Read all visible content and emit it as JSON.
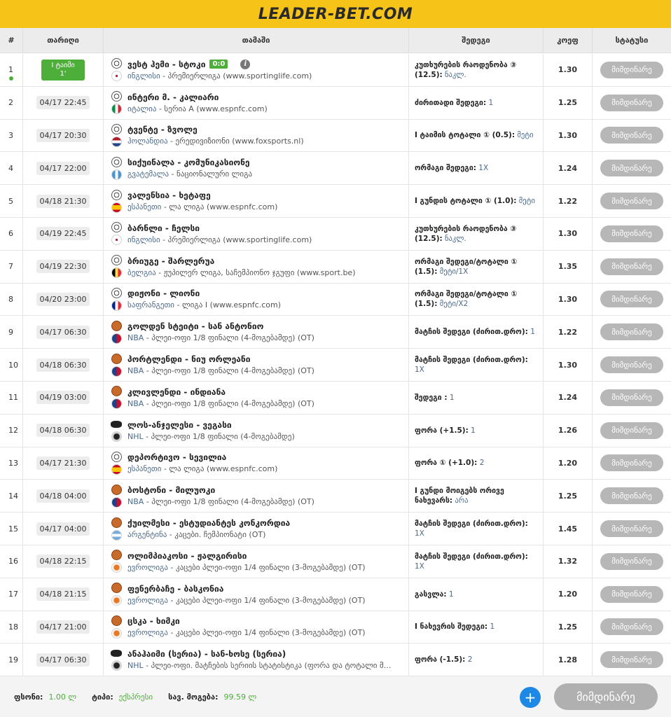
{
  "brand": {
    "logo": "LEADER-BET.COM"
  },
  "columns": {
    "num": "#",
    "date": "თარიღი",
    "game": "თამაში",
    "result": "შედეგი",
    "odd": "კოეფ",
    "status": "სტატუსი"
  },
  "rows": [
    {
      "num": "1",
      "live": true,
      "live_l1": "I ტაიმი",
      "live_l2": "1'",
      "date": "",
      "sport": "football",
      "flag": "england",
      "title": "ვესტ ჰემი - სტოკი",
      "score": "0:0",
      "league": "ინგლისი",
      "sub": " - პრემიერლიგა (www.sportinglife.com)",
      "res_label": "კუთხურების რაოდენობა ③ (12.5):",
      "res_value": "ნაკლ.",
      "odd": "1.30",
      "status": "მიმდინარე"
    },
    {
      "num": "2",
      "date": "04/17 22:45",
      "sport": "football",
      "flag": "italy",
      "title": "ინტერი მ. - კალიარი",
      "league": "იტალია",
      "sub": " - სერია A (www.espnfc.com)",
      "res_label": "ძირითადი შედეგი:",
      "res_value": "1",
      "odd": "1.25",
      "status": "მიმდინარე"
    },
    {
      "num": "3",
      "date": "04/17 20:30",
      "sport": "football",
      "flag": "netherlands",
      "title": "ტვენტე - ზვოლე",
      "league": "ჰოლანდია",
      "sub": " - ერედივიზიონი (www.foxsports.nl)",
      "res_label": "I ტაიმის ტოტალი ① (0.5):",
      "res_value": "მეტი",
      "odd": "1.30",
      "status": "მიმდინარე"
    },
    {
      "num": "4",
      "date": "04/17 22:00",
      "sport": "football",
      "flag": "guatemala",
      "title": "სიქუინალა - კომუნიკასიონე",
      "league": "გვატემალა",
      "sub": " - ნაციონალური ლიგა",
      "res_label": "ორმაგი შედეგი:",
      "res_value": "1X",
      "odd": "1.24",
      "status": "მიმდინარე"
    },
    {
      "num": "5",
      "date": "04/18 21:30",
      "sport": "football",
      "flag": "spain",
      "title": "ვალენსია - ხეტაფე",
      "league": "ესპანეთი",
      "sub": " - ლა ლიგა (www.espnfc.com)",
      "res_label": "I გუნდის ტოტალი ① (1.0):",
      "res_value": "მეტი",
      "odd": "1.22",
      "status": "მიმდინარე"
    },
    {
      "num": "6",
      "date": "04/19 22:45",
      "sport": "football",
      "flag": "england",
      "title": "ბარნლი - ჩელსი",
      "league": "ინგლისი",
      "sub": " - პრემიერლიგა (www.sportinglife.com)",
      "res_label": "კუთხურების რაოდენობა ③ (12.5):",
      "res_value": "ნაკლ.",
      "odd": "1.30",
      "status": "მიმდინარე"
    },
    {
      "num": "7",
      "date": "04/19 22:30",
      "sport": "football",
      "flag": "belgium",
      "title": "ბრიუგე - შარლერუა",
      "league": "ბელგია",
      "sub": " - ჟუპილერ ლიგა, საჩემპიონო ჯგუფი (www.sport.be)",
      "res_label": "ორმაგი შედეგი/ტოტალი ① (1.5):",
      "res_value": "მეტი/1X",
      "odd": "1.35",
      "status": "მიმდინარე"
    },
    {
      "num": "8",
      "date": "04/20 23:00",
      "sport": "football",
      "flag": "france",
      "title": "დიჟონი - ლიონი",
      "league": "საფრანგეთი",
      "sub": " - ლიგა I (www.espnfc.com)",
      "res_label": "ორმაგი შედეგი/ტოტალი ① (1.5):",
      "res_value": "მეტი/X2",
      "odd": "1.30",
      "status": "მიმდინარე"
    },
    {
      "num": "9",
      "date": "04/17 06:30",
      "sport": "basketball",
      "flag": "nba",
      "title": "გოლდენ სტეიტი - სან ანტონიო",
      "league": "NBA",
      "sub": " - პლეი-ოფი 1/8 ფინალი (4-მოგებამდე) (OT)",
      "res_label": "მატჩის შედეგი (ძირით.დრო):",
      "res_value": "1",
      "odd": "1.22",
      "status": "მიმდინარე"
    },
    {
      "num": "10",
      "date": "04/18 06:30",
      "sport": "basketball",
      "flag": "nba",
      "title": "პორტლენდი - ნიუ ორლეანი",
      "league": "NBA",
      "sub": " - პლეი-ოფი 1/8 ფინალი (4-მოგებამდე) (OT)",
      "res_label": "მატჩის შედეგი (ძირით.დრო):",
      "res_value": "1X",
      "odd": "1.30",
      "status": "მიმდინარე"
    },
    {
      "num": "11",
      "date": "04/19 03:00",
      "sport": "basketball",
      "flag": "nba",
      "title": "კლივლენდი - ინდიანა",
      "league": "NBA",
      "sub": " - პლეი-ოფი 1/8 ფინალი (4-მოგებამდე) (OT)",
      "res_label": "შედეგი :",
      "res_value": "1",
      "odd": "1.24",
      "status": "მიმდინარე"
    },
    {
      "num": "12",
      "date": "04/18 06:30",
      "sport": "hockey",
      "flag": "nhl",
      "title": "ლოს-ანჯელესი - ვეგასი",
      "league": "NHL",
      "sub": " - პლეი-ოფი 1/8 ფინალი (4-მოგებამდე)",
      "res_label": "ფორა (+1.5):",
      "res_value": "1",
      "odd": "1.26",
      "status": "მიმდინარე"
    },
    {
      "num": "13",
      "date": "04/17 21:30",
      "sport": "football",
      "flag": "spain",
      "title": "დეპორტივო - სევილია",
      "league": "ესპანეთი",
      "sub": " - ლა ლიგა (www.espnfc.com)",
      "res_label": "ფორა ① (+1.0):",
      "res_value": "2",
      "odd": "1.20",
      "status": "მიმდინარე"
    },
    {
      "num": "14",
      "date": "04/18 04:00",
      "sport": "basketball",
      "flag": "nba",
      "title": "ბოსტონი - მილუოკი",
      "league": "NBA",
      "sub": " - პლეი-ოფი 1/8 ფინალი (4-მოგებამდე) (OT)",
      "res_label": "I გუნდი მოიგებს ორივე ნახევარს:",
      "res_value": "არა",
      "odd": "1.25",
      "status": "მიმდინარე"
    },
    {
      "num": "15",
      "date": "04/17 04:00",
      "sport": "basketball",
      "flag": "argentina",
      "title": "ქუილმესი - ესტუდიანტეს კონკორდია",
      "league": "არგენტინა",
      "sub": " - კაცები. ჩემპიონატი (OT)",
      "res_label": "მატჩის შედეგი (ძირით.დრო):",
      "res_value": "1X",
      "odd": "1.45",
      "status": "მიმდინარე"
    },
    {
      "num": "16",
      "date": "04/18 22:15",
      "sport": "basketball",
      "flag": "euroleague",
      "title": "ოლიმპიაკოსი - ჟალგირისი",
      "league": "ევროლიგა",
      "sub": " - კაცები პლეი-ოფი 1/4 ფინალი (3-მოგებამდე) (OT)",
      "res_label": "მატჩის შედეგი (ძირით.დრო):",
      "res_value": "1X",
      "odd": "1.32",
      "status": "მიმდინარე"
    },
    {
      "num": "17",
      "date": "04/18 21:15",
      "sport": "basketball",
      "flag": "euroleague",
      "title": "ფენერბაჩე - ბასკონია",
      "league": "ევროლიგა",
      "sub": " - კაცები პლეი-ოფი 1/4 ფინალი (3-მოგებამდე) (OT)",
      "res_label": "გასვლა:",
      "res_value": "1",
      "odd": "1.20",
      "status": "მიმდინარე"
    },
    {
      "num": "18",
      "date": "04/17 21:00",
      "sport": "basketball",
      "flag": "euroleague",
      "title": "ცსკა - ხიმკი",
      "league": "ევროლიგა",
      "sub": " - კაცები პლეი-ოფი 1/4 ფინალი (3-მოგებამდე) (OT)",
      "res_label": "I ნახევრის შედეგი:",
      "res_value": "1",
      "odd": "1.25",
      "status": "მიმდინარე"
    },
    {
      "num": "19",
      "date": "04/17 06:30",
      "sport": "hockey",
      "flag": "nhl",
      "title": "ანაჰაიმი (სერია) - სან-ხოსე (სერია)",
      "league": "NHL",
      "sub": " - პლეი-ოფი. მატჩების სერიის სტატისტიკა (ფორა და ტოტალი მ...",
      "res_label": "ფორა (-1.5):",
      "res_value": "2",
      "odd": "1.28",
      "status": "მიმდინარე"
    }
  ],
  "footer": {
    "stake_label": "ფსონი:",
    "stake_value": "1.00 ლ",
    "type_label": "ტიპი:",
    "type_value": "ექსპრესი",
    "win_label": "სავ. მოგება:",
    "win_value": "99.59 ლ",
    "plus": "+",
    "status_button": "მიმდინარე"
  },
  "colors": {
    "brand": "#f6c318",
    "live": "#4eae3a",
    "status_btn": "#b7b7b7",
    "plus": "#1e88e5"
  }
}
